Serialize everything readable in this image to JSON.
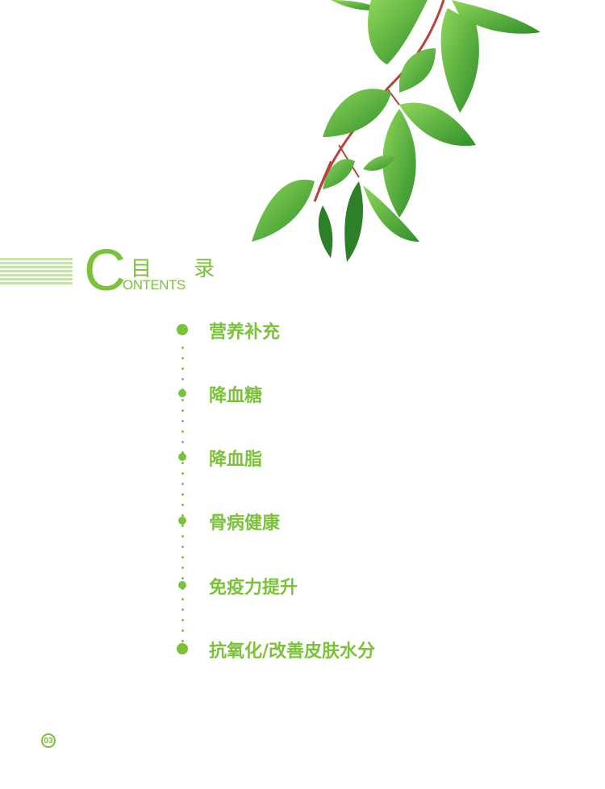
{
  "header": {
    "big_letter": "C",
    "title_cn": "目 录",
    "title_en": "ONTENTS"
  },
  "toc": {
    "items": [
      {
        "label": "营养补充"
      },
      {
        "label": "降血糖"
      },
      {
        "label": "降血脂"
      },
      {
        "label": "骨病健康"
      },
      {
        "label": "免疫力提升"
      },
      {
        "label": "抗氧化/改善皮肤水分"
      }
    ]
  },
  "footer": {
    "page_number": "03"
  },
  "colors": {
    "accent": "#7cc13a",
    "stripe": "#c7e3a6",
    "leaf_dark": "#3f9e2f",
    "leaf_light": "#6cc24a",
    "stem": "#b5453a"
  },
  "icons": {
    "decoration": "leaf-branch-illustration"
  }
}
